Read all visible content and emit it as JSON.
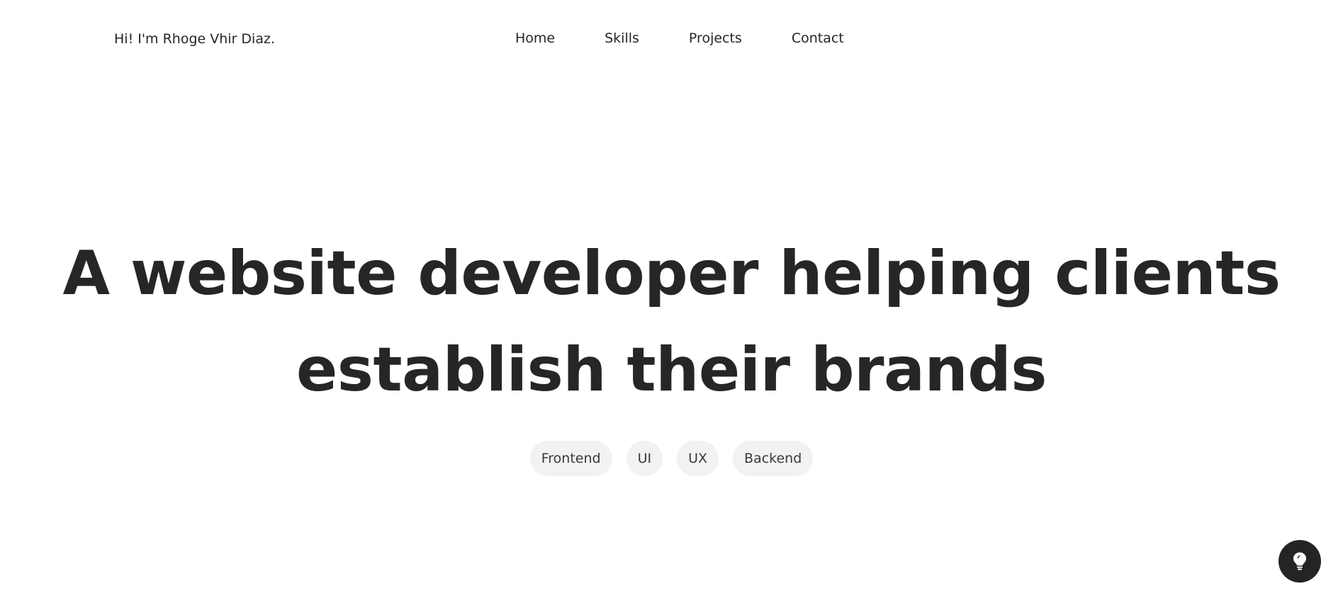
{
  "header": {
    "brand": "Hi! I'm Rhoge Vhir Diaz.",
    "nav": [
      {
        "label": "Home"
      },
      {
        "label": "Skills"
      },
      {
        "label": "Projects"
      },
      {
        "label": "Contact"
      }
    ]
  },
  "hero": {
    "title_line_1": "A website developer helping clients",
    "title_line_2": "establish their brands",
    "tags": [
      "Frontend",
      "UI",
      "UX",
      "Backend"
    ]
  },
  "theme_toggle": {
    "icon": "lightbulb-icon",
    "background": "#242424",
    "icon_color": "#ffffff"
  },
  "colors": {
    "text": "#262626",
    "tag_background": "#f2f2f2",
    "page_background": "#ffffff"
  }
}
